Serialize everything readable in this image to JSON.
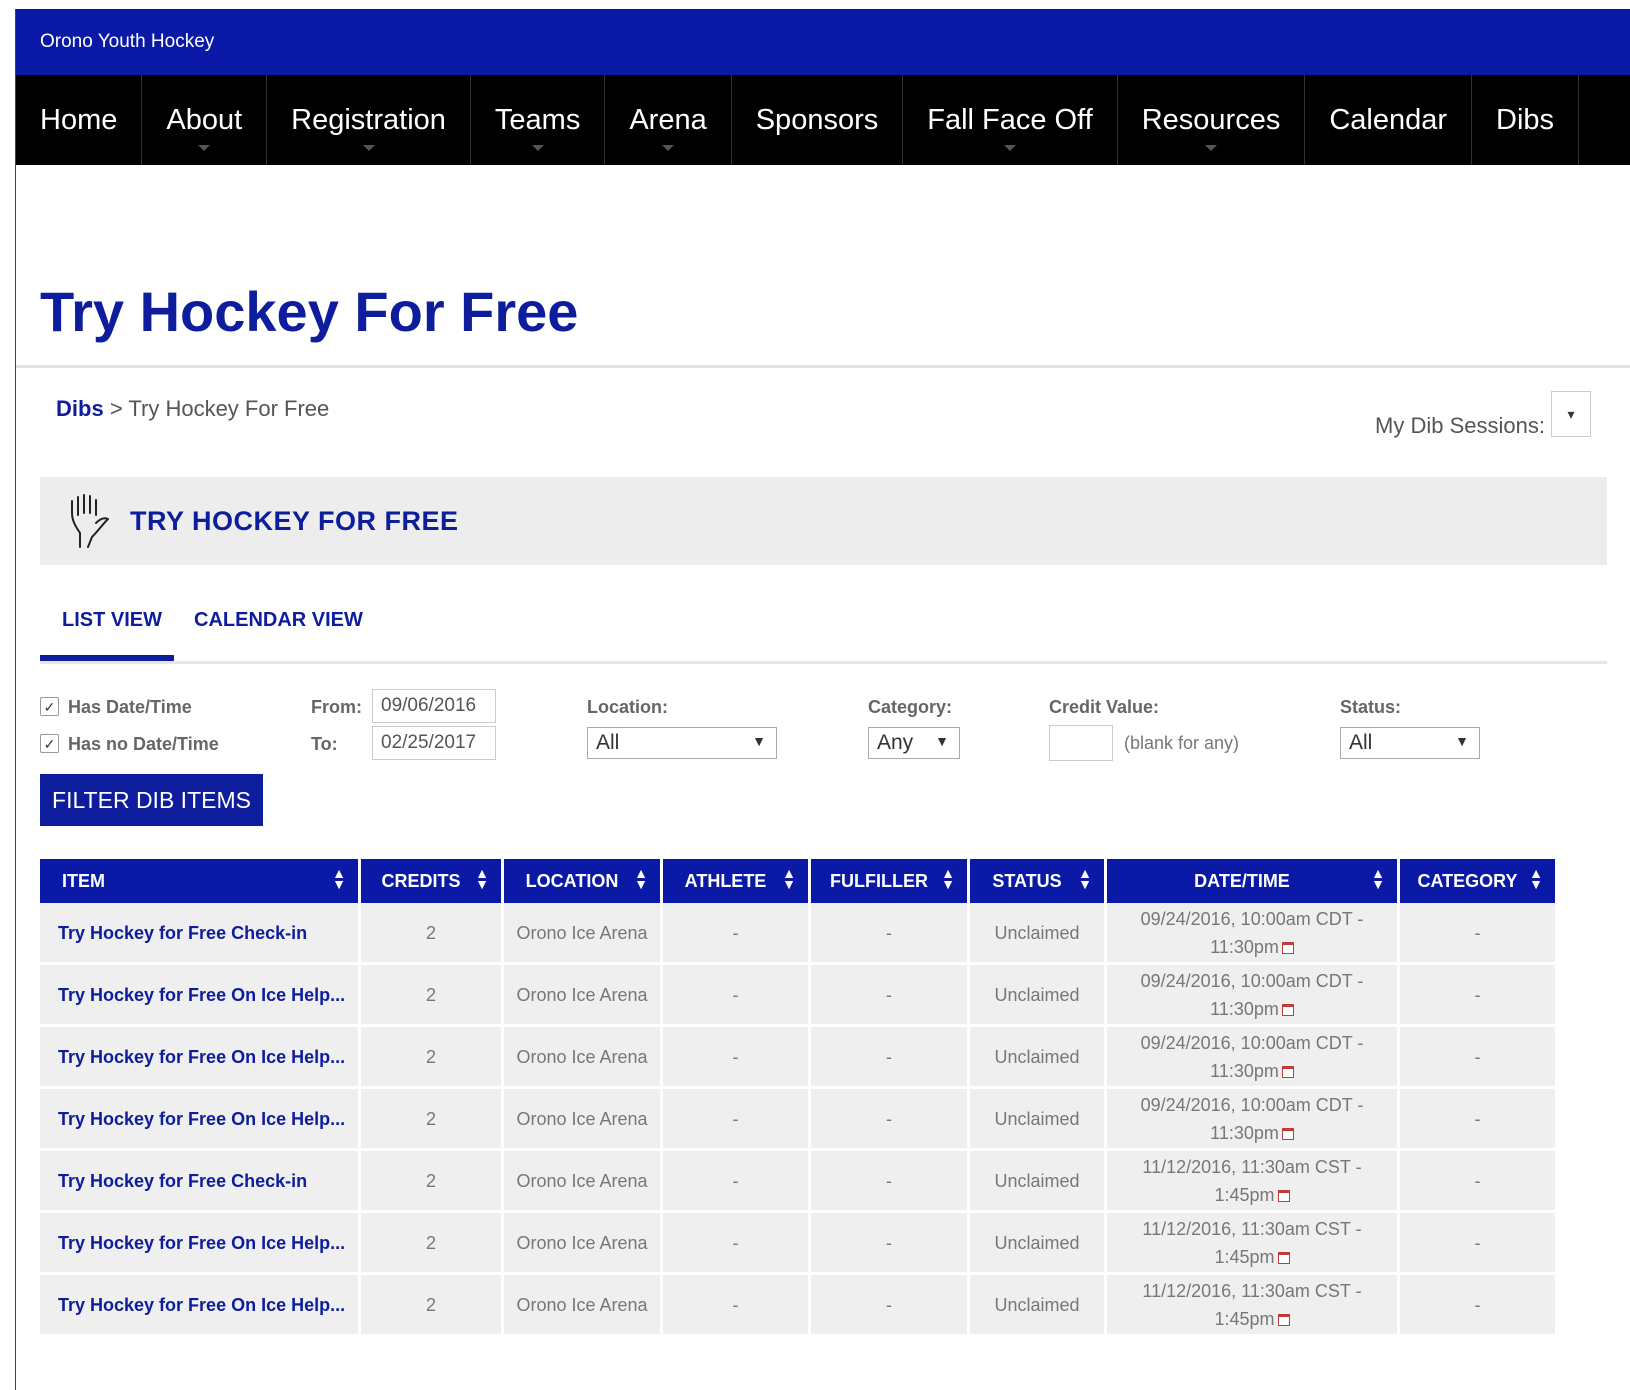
{
  "site_name": "Orono Youth Hockey",
  "nav": [
    {
      "label": "Home"
    },
    {
      "label": "About"
    },
    {
      "label": "Registration"
    },
    {
      "label": "Teams"
    },
    {
      "label": "Arena"
    },
    {
      "label": "Sponsors"
    },
    {
      "label": "Fall Face Off"
    },
    {
      "label": "Resources"
    },
    {
      "label": "Calendar"
    },
    {
      "label": "Dibs"
    }
  ],
  "page_title": "Try Hockey For Free",
  "breadcrumb": {
    "link": "Dibs",
    "separator": ">",
    "current": "Try Hockey For Free"
  },
  "my_sessions": {
    "label": "My Dib Sessions:",
    "value": "▾"
  },
  "header": {
    "title": "TRY HOCKEY FOR FREE",
    "icon": "hand-icon"
  },
  "tabs": [
    {
      "label": "LIST VIEW",
      "active": true
    },
    {
      "label": "CALENDAR VIEW",
      "active": false
    }
  ],
  "filters": {
    "has_date_time": {
      "label": "Has Date/Time",
      "checked": true
    },
    "has_no_date_time": {
      "label": "Has no Date/Time",
      "checked": true
    },
    "from_label": "From:",
    "from_value": "09/06/2016",
    "to_label": "To:",
    "to_value": "02/25/2017",
    "location_label": "Location:",
    "location_value": "All",
    "category_label": "Category:",
    "category_value": "Any",
    "credit_label": "Credit Value:",
    "credit_hint": "(blank for any)",
    "status_label": "Status:",
    "status_value": "All",
    "button": "FILTER DIB ITEMS"
  },
  "table": {
    "columns": [
      "Item",
      "Credits",
      "Location",
      "Athlete",
      "Fulfiller",
      "Status",
      "Date/Time",
      "Category"
    ],
    "rows": [
      {
        "item": "Try Hockey for Free Check-in",
        "credits": "2",
        "location": "Orono Ice Arena",
        "athlete": "-",
        "fulfiller": "-",
        "status": "Unclaimed",
        "dt_line1": "09/24/2016, 10:00am CDT -",
        "dt_line2": "11:30pm",
        "category": "-"
      },
      {
        "item": "Try Hockey for Free On Ice Help...",
        "credits": "2",
        "location": "Orono Ice Arena",
        "athlete": "-",
        "fulfiller": "-",
        "status": "Unclaimed",
        "dt_line1": "09/24/2016, 10:00am CDT -",
        "dt_line2": "11:30pm",
        "category": "-"
      },
      {
        "item": "Try Hockey for Free On Ice Help...",
        "credits": "2",
        "location": "Orono Ice Arena",
        "athlete": "-",
        "fulfiller": "-",
        "status": "Unclaimed",
        "dt_line1": "09/24/2016, 10:00am CDT -",
        "dt_line2": "11:30pm",
        "category": "-"
      },
      {
        "item": "Try Hockey for Free On Ice Help...",
        "credits": "2",
        "location": "Orono Ice Arena",
        "athlete": "-",
        "fulfiller": "-",
        "status": "Unclaimed",
        "dt_line1": "09/24/2016, 10:00am CDT -",
        "dt_line2": "11:30pm",
        "category": "-"
      },
      {
        "item": "Try Hockey for Free Check-in",
        "credits": "2",
        "location": "Orono Ice Arena",
        "athlete": "-",
        "fulfiller": "-",
        "status": "Unclaimed",
        "dt_line1": "11/12/2016, 11:30am CST -",
        "dt_line2": "1:45pm",
        "category": "-"
      },
      {
        "item": "Try Hockey for Free On Ice Help...",
        "credits": "2",
        "location": "Orono Ice Arena",
        "athlete": "-",
        "fulfiller": "-",
        "status": "Unclaimed",
        "dt_line1": "11/12/2016, 11:30am CST -",
        "dt_line2": "1:45pm",
        "category": "-"
      },
      {
        "item": "Try Hockey for Free On Ice Help...",
        "credits": "2",
        "location": "Orono Ice Arena",
        "athlete": "-",
        "fulfiller": "-",
        "status": "Unclaimed",
        "dt_line1": "11/12/2016, 11:30am CST -",
        "dt_line2": "1:45pm",
        "category": "-"
      }
    ]
  }
}
